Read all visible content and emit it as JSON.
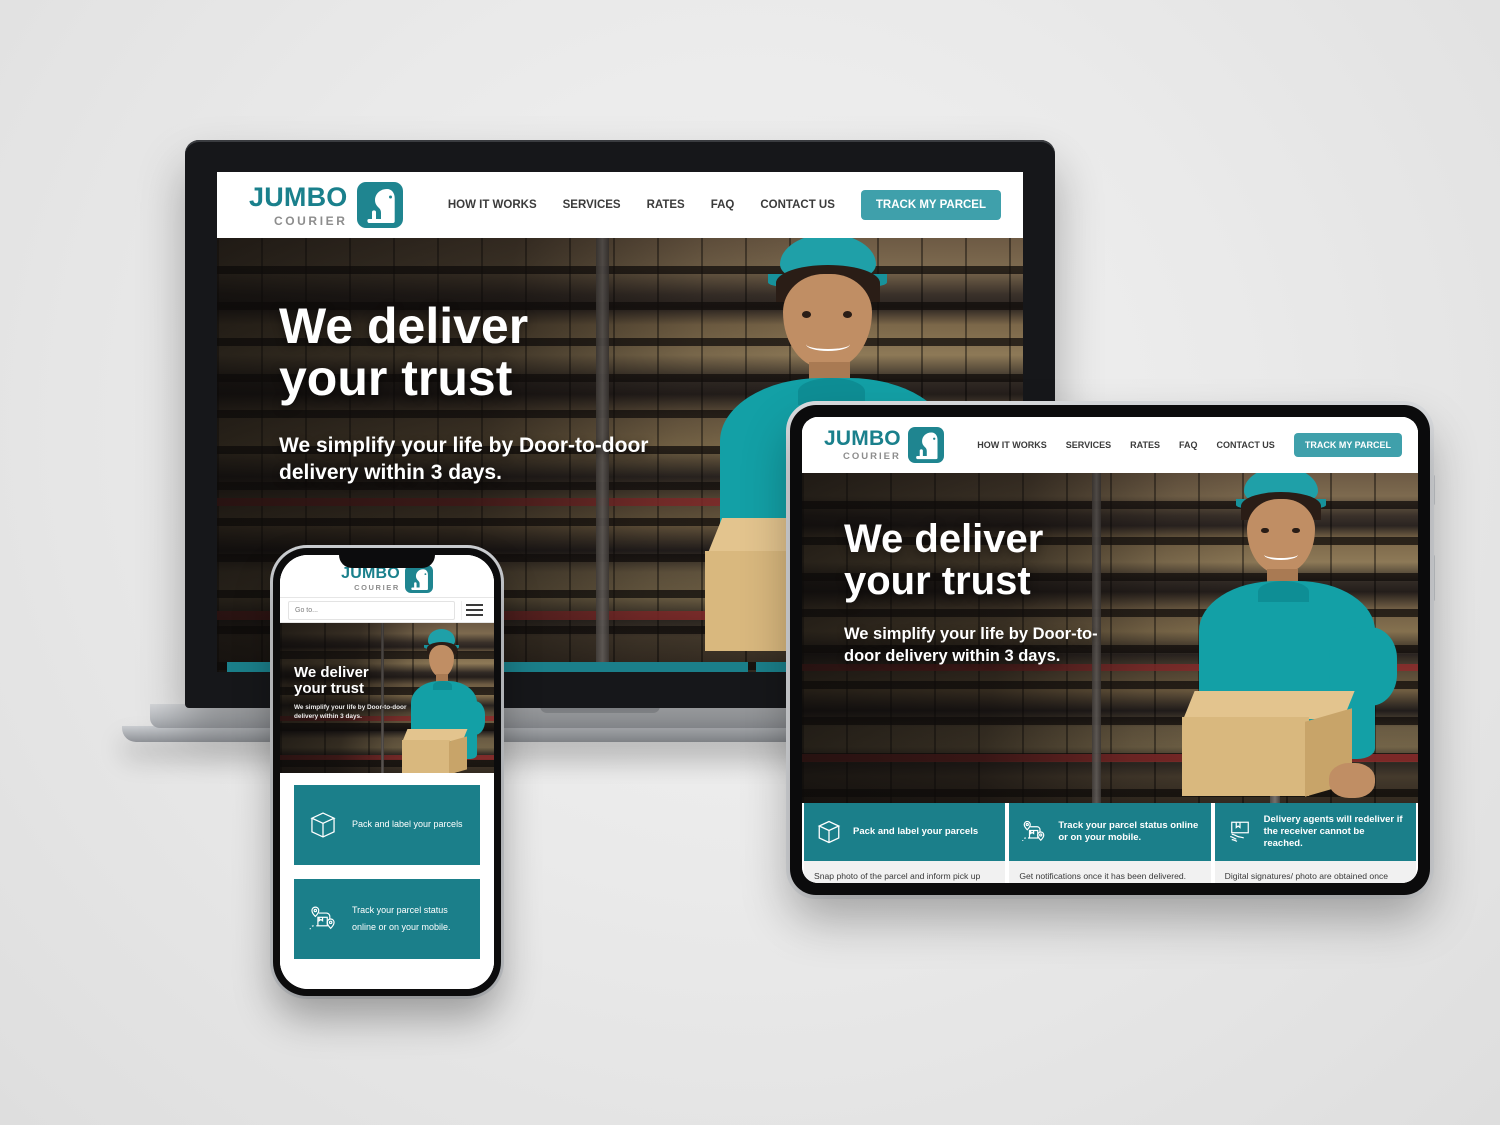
{
  "brand": {
    "name_top": "JUMBO",
    "name_bottom": "COURIER",
    "logo_icon": "elephant-icon",
    "teal": "#1f8590",
    "card_teal": "#1b7f8a",
    "cta_teal": "#3fa0ab",
    "gray_text": "#8d8d8d"
  },
  "nav": {
    "items": [
      {
        "label": "HOW IT WORKS"
      },
      {
        "label": "SERVICES"
      },
      {
        "label": "RATES"
      },
      {
        "label": "FAQ"
      },
      {
        "label": "CONTACT US"
      }
    ],
    "cta_label": "TRACK MY PARCEL"
  },
  "hero": {
    "heading_line1": "We deliver",
    "heading_line2": "your trust",
    "paragraph": "We simplify your life by Door-to-door delivery within 3 days."
  },
  "features": [
    {
      "icon": "package-box-icon",
      "title": "Pack and label your parcels",
      "body": "Snap photo of the parcel and inform pick up date and location."
    },
    {
      "icon": "route-tracking-icon",
      "title": "Track your parcel status online or on your mobile.",
      "body": "Get notifications once it has been delivered."
    },
    {
      "icon": "hand-delivery-icon",
      "title": "Delivery agents will redeliver if the receiver cannot be reached.",
      "body": "Digital signatures/ photo are obtained once delivered."
    }
  ],
  "mobile": {
    "search_placeholder": "Go to...",
    "menu_icon": "hamburger-menu-icon"
  },
  "devices": {
    "laptop": "laptop-mockup",
    "tablet": "tablet-mockup",
    "phone": "phone-mockup"
  }
}
